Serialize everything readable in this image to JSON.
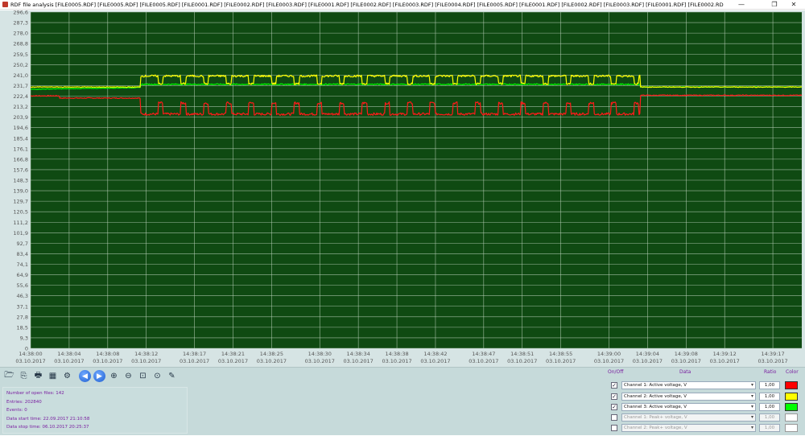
{
  "window": {
    "title": "RDF file analysis [FILE0005.RDF] [FILE0005.RDF] [FILE0005.RDF] [FILE0001.RDF] [FILE0002.RDF] [FILE0003.RDF] [FILE0001.RDF] [FILE0002.RDF] [FILE0003.RDF] [FILE0004.RDF] [FILE0005.RDF] [FILE0001.RDF] [FILE0002.RDF] [FILE0003.RDF] [FILE0001.RDF] [FILE0002.RD",
    "minimize": "—",
    "maximize": "❐",
    "close": "✕"
  },
  "chart_data": {
    "type": "line",
    "background": "#0f4a12",
    "grid_color": "#bcd2bc",
    "ylim": [
      0,
      305
    ],
    "yticks": [
      "296,6",
      "287,3",
      "278,0",
      "268,8",
      "259,5",
      "250,2",
      "241,0",
      "231,7",
      "222,4",
      "213,2",
      "203,9",
      "194,6",
      "185,4",
      "176,1",
      "166,8",
      "157,6",
      "148,3",
      "139,0",
      "129,7",
      "120,5",
      "111,2",
      "101,9",
      "92,7",
      "83,4",
      "74,1",
      "64,9",
      "55,6",
      "46,3",
      "37,1",
      "27,8",
      "18,5",
      "9,3",
      "0"
    ],
    "xticks": [
      {
        "time": "14:38:00",
        "date": "03.10.2017"
      },
      {
        "time": "14:38:04",
        "date": "03.10.2017"
      },
      {
        "time": "14:38:08",
        "date": "03.10.2017"
      },
      {
        "time": "14:38:12",
        "date": "03.10.2017"
      },
      {
        "time": "14:38:17",
        "date": "03.10.2017"
      },
      {
        "time": "14:38:21",
        "date": "03.10.2017"
      },
      {
        "time": "14:38:25",
        "date": "03.10.2017"
      },
      {
        "time": "14:38:30",
        "date": "03.10.2017"
      },
      {
        "time": "14:38:34",
        "date": "03.10.2017"
      },
      {
        "time": "14:38:38",
        "date": "03.10.2017"
      },
      {
        "time": "14:38:42",
        "date": "03.10.2017"
      },
      {
        "time": "14:38:47",
        "date": "03.10.2017"
      },
      {
        "time": "14:38:51",
        "date": "03.10.2017"
      },
      {
        "time": "14:38:55",
        "date": "03.10.2017"
      },
      {
        "time": "14:39:00",
        "date": "03.10.2017"
      },
      {
        "time": "14:39:04",
        "date": "03.10.2017"
      },
      {
        "time": "14:39:08",
        "date": "03.10.2017"
      },
      {
        "time": "14:39:12",
        "date": "03.10.2017"
      },
      {
        "time": "14:39:17",
        "date": "03.10.2017"
      }
    ],
    "x_seconds": [
      0,
      4,
      8,
      12,
      17,
      21,
      25,
      30,
      34,
      38,
      42,
      47,
      51,
      55,
      60,
      64,
      68,
      72,
      77
    ],
    "x_range_seconds": [
      0,
      80
    ],
    "series": [
      {
        "name": "Channel 1: Active voltage, V",
        "color": "#ff1a1a",
        "baseline_level": 229.0,
        "baseline_before_dip": 227.0,
        "active_level": 212.5,
        "pulse_level": 222.5,
        "active_range_seconds": [
          11.4,
          63.2
        ],
        "pulse_period_seconds": 2.35
      },
      {
        "name": "Channel 2: Active voltage, V",
        "color": "#ffff00",
        "baseline_level": 237.0,
        "active_level": 247.0,
        "dip_level": 240.0,
        "active_range_seconds": [
          11.4,
          63.2
        ],
        "pulse_period_seconds": 2.35
      },
      {
        "name": "Channel 3: Active voltage, V",
        "color": "#00ff00",
        "start_level": 235.0,
        "end_level": 239.5,
        "active_range_seconds": [
          11.4,
          63.2
        ]
      }
    ]
  },
  "toolbar": {
    "buttons": [
      {
        "name": "open-file-icon",
        "glyph": "🗁"
      },
      {
        "name": "export-icon",
        "glyph": "⎘"
      },
      {
        "name": "print-icon",
        "glyph": "🖶"
      },
      {
        "name": "image-icon",
        "glyph": "▦"
      },
      {
        "name": "settings-icon",
        "glyph": "⚙"
      },
      {
        "name": "back-icon",
        "glyph": "◀"
      },
      {
        "name": "forward-icon",
        "glyph": "▶"
      },
      {
        "name": "zoom-in-icon",
        "glyph": "⊕"
      },
      {
        "name": "zoom-out-icon",
        "glyph": "⊖"
      },
      {
        "name": "zoom-region-icon",
        "glyph": "⊡"
      },
      {
        "name": "zoom-fit-icon",
        "glyph": "⊙"
      },
      {
        "name": "measure-icon",
        "glyph": "✎"
      }
    ]
  },
  "info": {
    "open_files": "Number of open files: 142",
    "entries": "Entries: 202840",
    "events": "Events: 0",
    "start_time": "Data start time: 22.09.2017 21:10:58",
    "stop_time": "Data stop time: 06.10.2017 20:25:37"
  },
  "channels": {
    "headers": {
      "onoff": "On/Off",
      "data": "Data",
      "ratio": "Ratio",
      "color": "Color"
    },
    "rows": [
      {
        "checked": "✓",
        "label": "Channel 1: Active voltage, V",
        "ratio": "1,00",
        "color": "#ff0000",
        "enabled": true
      },
      {
        "checked": "✓",
        "label": "Channel 2: Active voltage, V",
        "ratio": "1,00",
        "color": "#ffff00",
        "enabled": true
      },
      {
        "checked": "✓",
        "label": "Channel 3: Active voltage, V",
        "ratio": "1,00",
        "color": "#00ff00",
        "enabled": true
      },
      {
        "checked": "",
        "label": "Channel 1: Peak+ voltage, V",
        "ratio": "1,00",
        "color": "#ffffff",
        "enabled": false
      },
      {
        "checked": "",
        "label": "Channel 2: Peak+ voltage, V",
        "ratio": "1,00",
        "color": "#ffffff",
        "enabled": false
      }
    ]
  }
}
